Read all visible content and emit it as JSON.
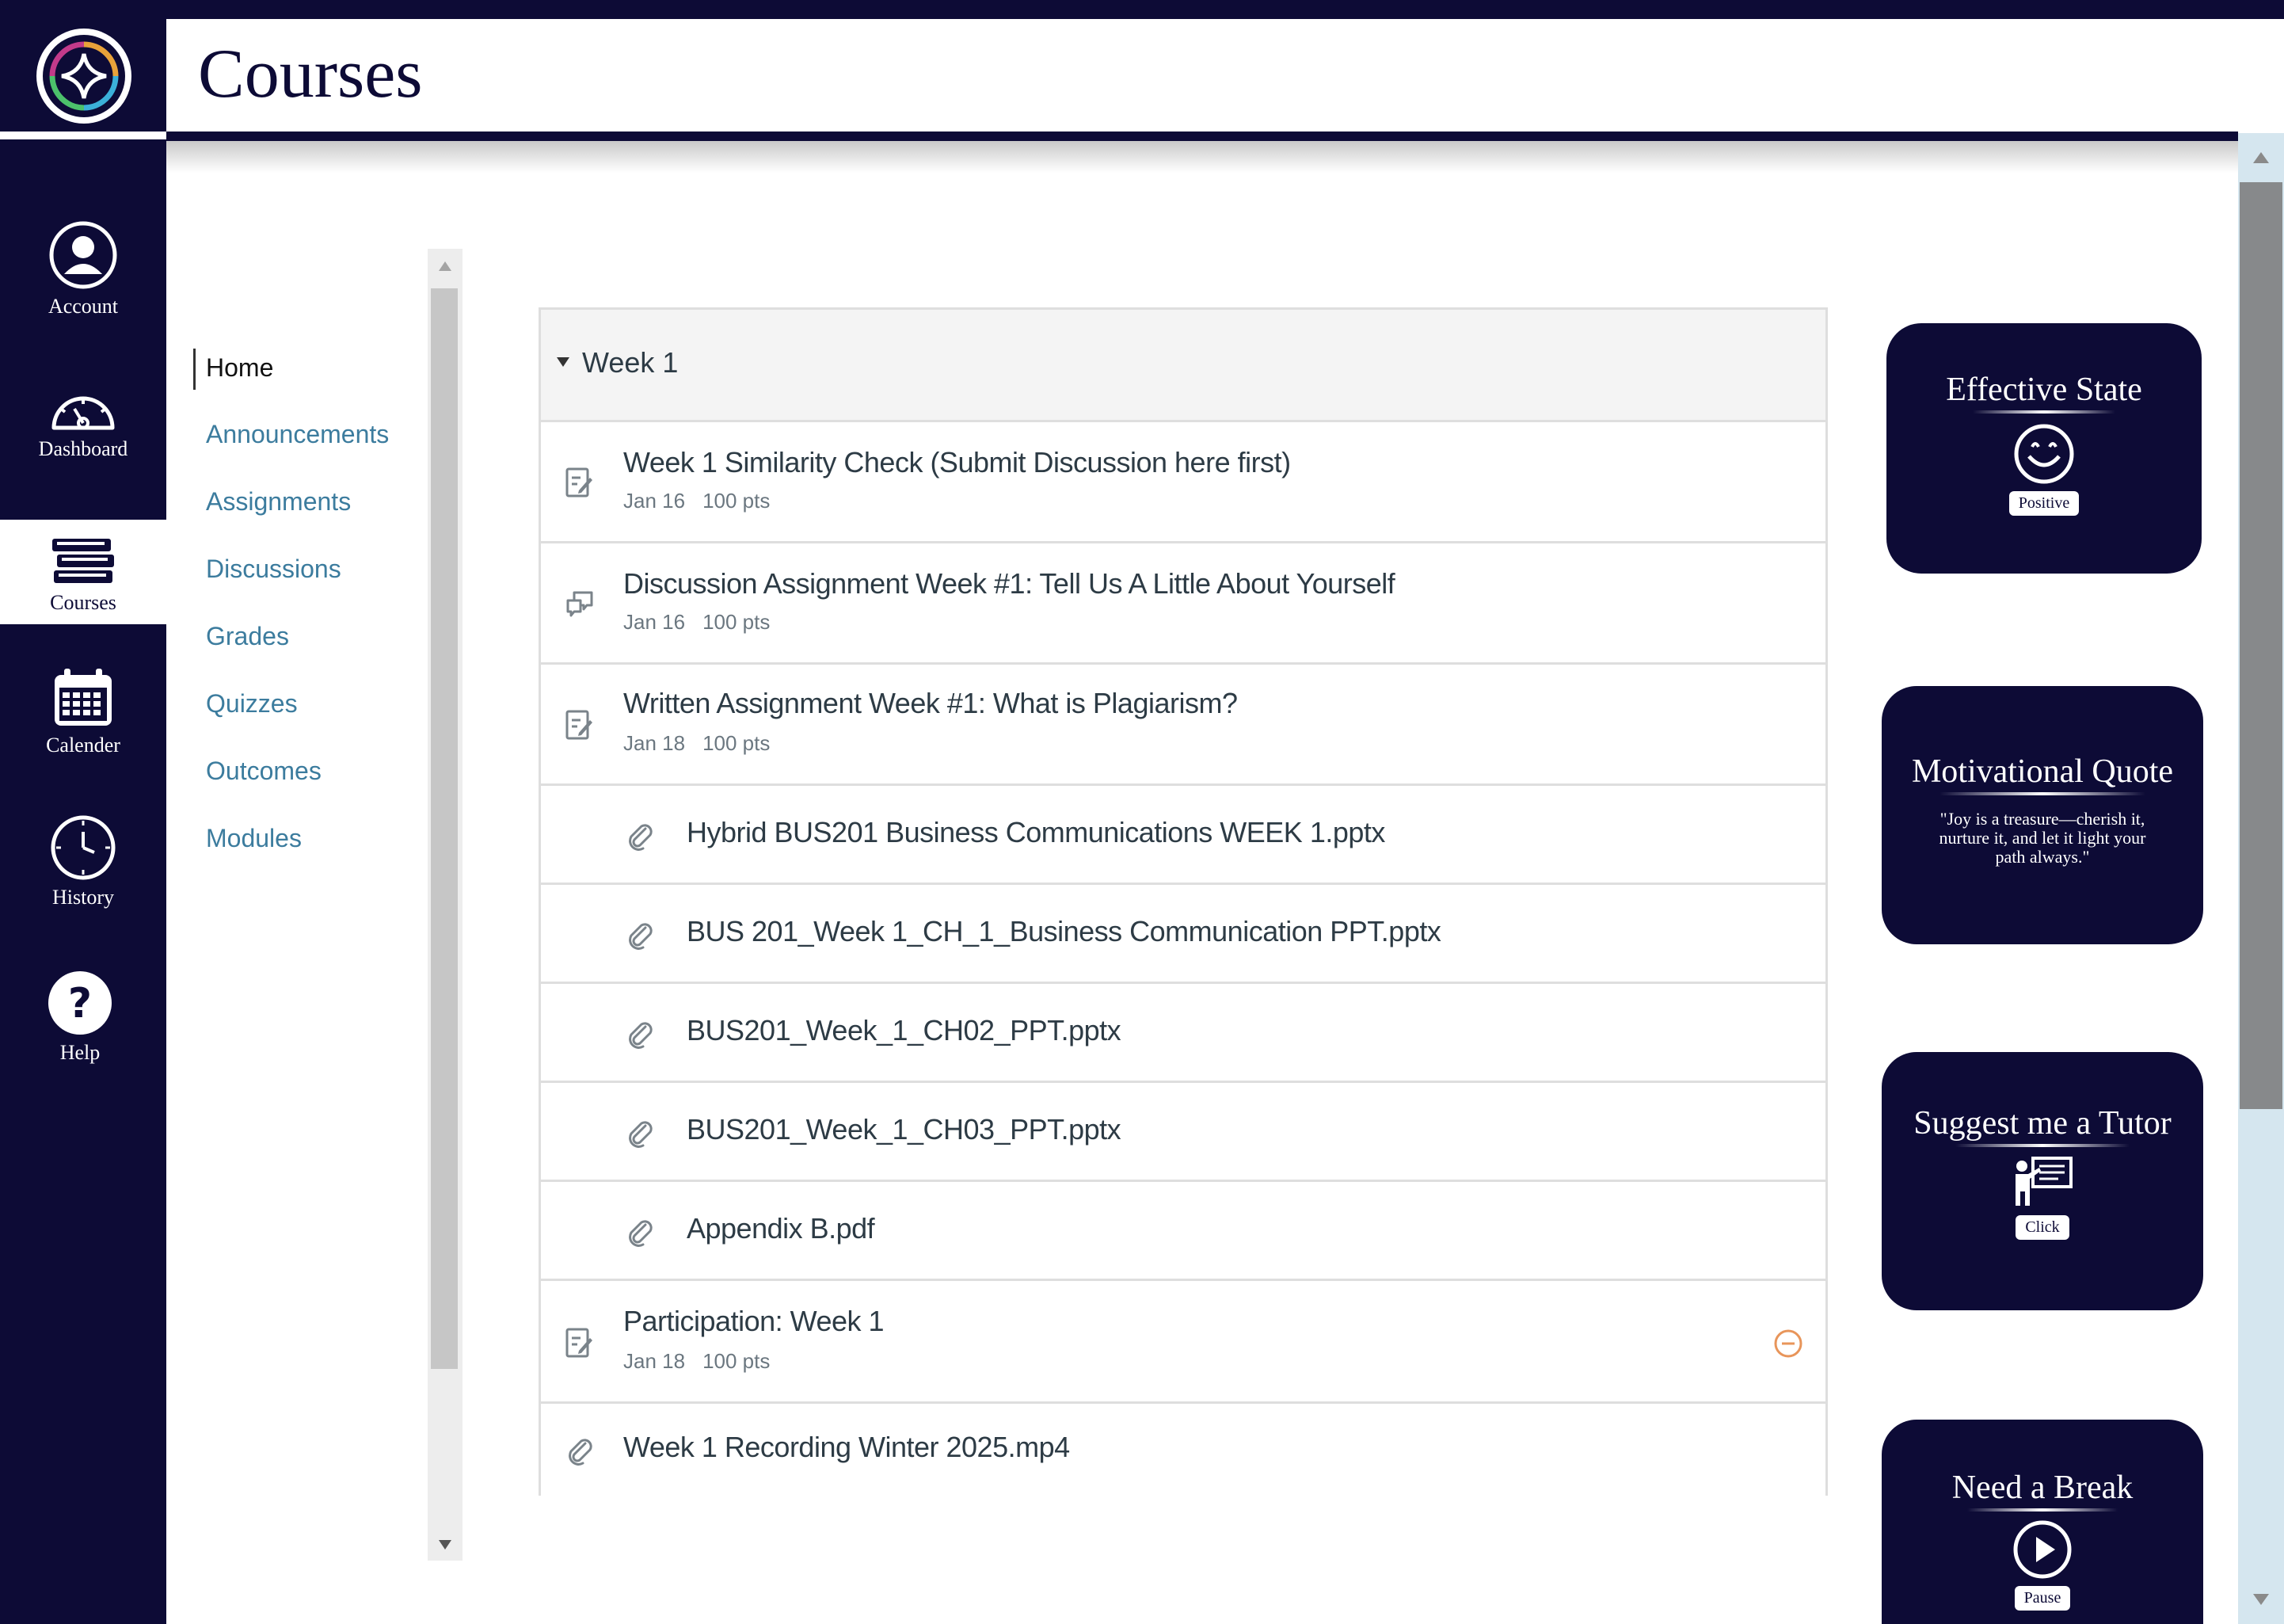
{
  "header": {
    "title": "Courses"
  },
  "rail": {
    "items": [
      {
        "label": "Account",
        "icon": "account-icon"
      },
      {
        "label": "Dashboard",
        "icon": "dashboard-gauge-icon"
      },
      {
        "label": "Courses",
        "icon": "books-icon",
        "active": true
      },
      {
        "label": "Calender",
        "icon": "calendar-icon"
      },
      {
        "label": "History",
        "icon": "clock-icon"
      },
      {
        "label": "Help",
        "icon": "question-icon"
      }
    ]
  },
  "course_nav": {
    "items": [
      {
        "label": "Home",
        "active": true
      },
      {
        "label": "Announcements"
      },
      {
        "label": "Assignments"
      },
      {
        "label": "Discussions"
      },
      {
        "label": "Grades"
      },
      {
        "label": "Quizzes"
      },
      {
        "label": "Outcomes"
      },
      {
        "label": "Modules"
      }
    ]
  },
  "module": {
    "title": "Week 1",
    "items": [
      {
        "type": "assignment",
        "title": "Week 1 Similarity Check (Submit Discussion here first)",
        "date": "Jan 16",
        "points": "100 pts"
      },
      {
        "type": "discussion",
        "title": "Discussion Assignment Week #1: Tell Us A Little About Yourself",
        "date": "Jan 16",
        "points": "100 pts"
      },
      {
        "type": "assignment",
        "title": "Written Assignment Week #1: What is Plagiarism?",
        "date": "Jan 18",
        "points": "100 pts"
      },
      {
        "type": "attachment",
        "title": "Hybrid BUS201 Business Communications WEEK 1.pptx"
      },
      {
        "type": "attachment",
        "title": "BUS 201_Week 1_CH_1_Business Communication PPT.pptx"
      },
      {
        "type": "attachment",
        "title": "BUS201_Week_1_CH02_PPT.pptx"
      },
      {
        "type": "attachment",
        "title": "BUS201_Week_1_CH03_PPT.pptx"
      },
      {
        "type": "attachment",
        "title": "Appendix B.pdf"
      },
      {
        "type": "assignment",
        "title": "Participation: Week 1",
        "date": "Jan 18",
        "points": "100 pts"
      },
      {
        "type": "attachment",
        "title": "Week 1 Recording Winter 2025.mp4"
      }
    ]
  },
  "cards": {
    "effective_state": {
      "title": "Effective State",
      "value": "Positive",
      "icon": "smiley-face-icon"
    },
    "quote": {
      "title": "Motivational Quote",
      "text": "\"Joy is a treasure—cherish it, nurture it, and let it light your path always.\""
    },
    "tutor": {
      "title": "Suggest me a Tutor",
      "button": "Click",
      "icon": "tutor-board-icon"
    },
    "break": {
      "title": "Need a Break",
      "button": "Pause",
      "icon": "play-icon"
    }
  },
  "colors": {
    "navy": "#0d0b36",
    "link": "#3c7c9e",
    "muted_icon": "#e8955a"
  }
}
